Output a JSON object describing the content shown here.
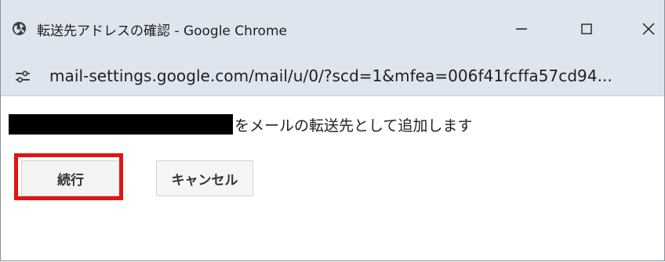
{
  "window": {
    "title": "転送先アドレスの確認 - Google Chrome",
    "controls": {
      "minimize_icon": "minimize-icon",
      "maximize_icon": "maximize-icon",
      "close_icon": "close-icon"
    }
  },
  "address_bar": {
    "site_info_icon": "tune-icon",
    "url": "mail-settings.google.com/mail/u/0/?scd=1&mfea=006f41fcffa57cd94..."
  },
  "dialog": {
    "message": "をメールの転送先として追加します",
    "redacted_email": "",
    "continue_label": "続行",
    "cancel_label": "キャンセル"
  },
  "colors": {
    "titlebar_bg": "#dfe5ef",
    "highlight": "#e31414",
    "button_bg": "#f3f3f3"
  }
}
